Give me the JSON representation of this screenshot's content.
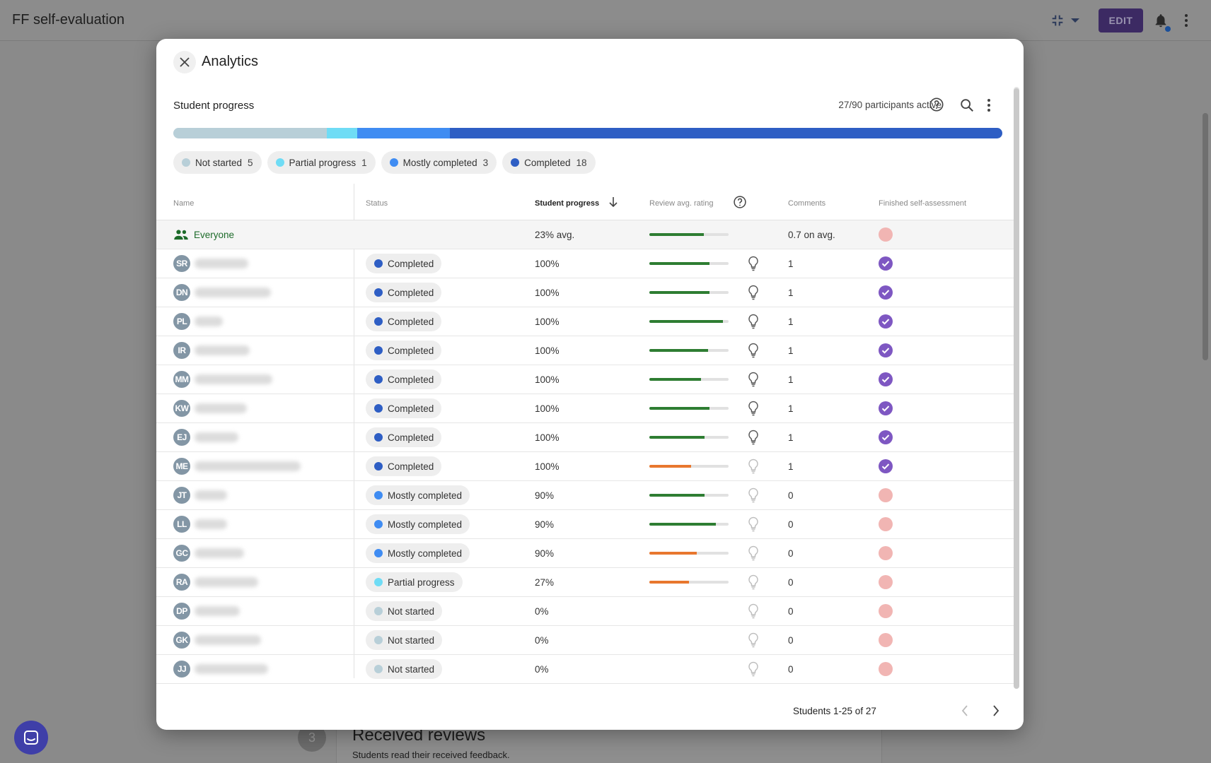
{
  "app": {
    "title": "FF self-evaluation",
    "edit_label": "EDIT",
    "step_number": "3",
    "bg_heading": "Received reviews",
    "bg_sub": "Students read their received feedback."
  },
  "modal": {
    "title": "Analytics",
    "section_title": "Student progress",
    "participants": "27/90 participants active",
    "footer": "Students 1-25 of 27"
  },
  "colors": {
    "not_started": "#b8cfd8",
    "partial": "#6fdcf5",
    "mostly": "#3f8cf2",
    "completed": "#2e5ec4",
    "rating_green": "#2e7d32",
    "rating_orange": "#e8772e",
    "check_purple": "#7e57c2",
    "everyone_green": "#1d6b2a"
  },
  "progress_bar": [
    {
      "status": "not_started",
      "count": 5
    },
    {
      "status": "partial",
      "count": 1
    },
    {
      "status": "mostly",
      "count": 3
    },
    {
      "status": "completed",
      "count": 18
    }
  ],
  "legend": [
    {
      "key": "not_started",
      "label": "Not started",
      "count": "5"
    },
    {
      "key": "partial",
      "label": "Partial progress",
      "count": "1"
    },
    {
      "key": "mostly",
      "label": "Mostly completed",
      "count": "3"
    },
    {
      "key": "completed",
      "label": "Completed",
      "count": "18"
    }
  ],
  "columns": {
    "name": "Name",
    "status": "Status",
    "progress": "Student progress",
    "rating": "Review avg. rating",
    "comments": "Comments",
    "finished": "Finished self-assessment"
  },
  "everyone": {
    "label": "Everyone",
    "progress": "23% avg.",
    "rating": 0.69,
    "comments": "0.7 on avg.",
    "finished": false
  },
  "rows": [
    {
      "initials": "SR",
      "name_w": 76,
      "status": "completed",
      "status_label": "Completed",
      "progress": "100%",
      "rating": 0.76,
      "rating_color": "green",
      "idea_active": true,
      "comments": "1",
      "finished": true
    },
    {
      "initials": "DN",
      "name_w": 108,
      "status": "completed",
      "status_label": "Completed",
      "progress": "100%",
      "rating": 0.76,
      "rating_color": "green",
      "idea_active": true,
      "comments": "1",
      "finished": true
    },
    {
      "initials": "PL",
      "name_w": 40,
      "status": "completed",
      "status_label": "Completed",
      "progress": "100%",
      "rating": 0.93,
      "rating_color": "green",
      "idea_active": true,
      "comments": "1",
      "finished": true
    },
    {
      "initials": "IR",
      "name_w": 78,
      "status": "completed",
      "status_label": "Completed",
      "progress": "100%",
      "rating": 0.74,
      "rating_color": "green",
      "idea_active": true,
      "comments": "1",
      "finished": true
    },
    {
      "initials": "MM",
      "name_w": 110,
      "status": "completed",
      "status_label": "Completed",
      "progress": "100%",
      "rating": 0.65,
      "rating_color": "green",
      "idea_active": true,
      "comments": "1",
      "finished": true
    },
    {
      "initials": "KW",
      "name_w": 74,
      "status": "completed",
      "status_label": "Completed",
      "progress": "100%",
      "rating": 0.76,
      "rating_color": "green",
      "idea_active": true,
      "comments": "1",
      "finished": true
    },
    {
      "initials": "EJ",
      "name_w": 62,
      "status": "completed",
      "status_label": "Completed",
      "progress": "100%",
      "rating": 0.7,
      "rating_color": "green",
      "idea_active": true,
      "comments": "1",
      "finished": true
    },
    {
      "initials": "ME",
      "name_w": 150,
      "status": "completed",
      "status_label": "Completed",
      "progress": "100%",
      "rating": 0.53,
      "rating_color": "orange",
      "idea_active": false,
      "comments": "1",
      "finished": true
    },
    {
      "initials": "JT",
      "name_w": 46,
      "status": "mostly",
      "status_label": "Mostly completed",
      "progress": "90%",
      "rating": 0.7,
      "rating_color": "green",
      "idea_active": false,
      "comments": "0",
      "finished": false
    },
    {
      "initials": "LL",
      "name_w": 46,
      "status": "mostly",
      "status_label": "Mostly completed",
      "progress": "90%",
      "rating": 0.84,
      "rating_color": "green",
      "idea_active": false,
      "comments": "0",
      "finished": false
    },
    {
      "initials": "GC",
      "name_w": 70,
      "status": "mostly",
      "status_label": "Mostly completed",
      "progress": "90%",
      "rating": 0.6,
      "rating_color": "orange",
      "idea_active": false,
      "comments": "0",
      "finished": false
    },
    {
      "initials": "RA",
      "name_w": 90,
      "status": "partial",
      "status_label": "Partial progress",
      "progress": "27%",
      "rating": 0.5,
      "rating_color": "orange",
      "idea_active": false,
      "comments": "0",
      "finished": false
    },
    {
      "initials": "DP",
      "name_w": 64,
      "status": "not_started",
      "status_label": "Not started",
      "progress": "0%",
      "rating": null,
      "rating_color": null,
      "idea_active": false,
      "comments": "0",
      "finished": false
    },
    {
      "initials": "GK",
      "name_w": 94,
      "status": "not_started",
      "status_label": "Not started",
      "progress": "0%",
      "rating": null,
      "rating_color": null,
      "idea_active": false,
      "comments": "0",
      "finished": false
    },
    {
      "initials": "JJ",
      "name_w": 104,
      "status": "not_started",
      "status_label": "Not started",
      "progress": "0%",
      "rating": null,
      "rating_color": null,
      "idea_active": false,
      "comments": "0",
      "finished": false
    }
  ]
}
